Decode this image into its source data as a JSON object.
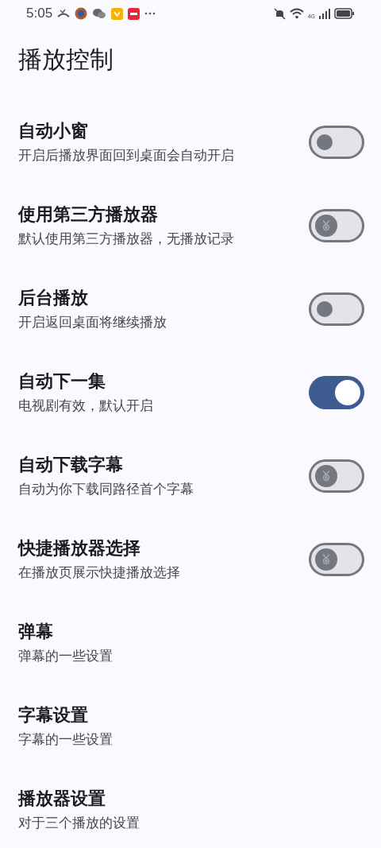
{
  "status_bar": {
    "time": "5:05",
    "network": "4G"
  },
  "title": "播放控制",
  "settings": [
    {
      "kind": "toggle",
      "title": "自动小窗",
      "subtitle": "开启后播放界面回到桌面会自动开启",
      "on": false,
      "badge": false
    },
    {
      "kind": "toggle",
      "title": "使用第三方播放器",
      "subtitle": "默认使用第三方播放器，无播放记录",
      "on": false,
      "badge": true
    },
    {
      "kind": "toggle",
      "title": "后台播放",
      "subtitle": "开启返回桌面将继续播放",
      "on": false,
      "badge": false
    },
    {
      "kind": "toggle",
      "title": "自动下一集",
      "subtitle": "电视剧有效，默认开启",
      "on": true,
      "badge": false
    },
    {
      "kind": "toggle",
      "title": "自动下载字幕",
      "subtitle": "自动为你下载同路径首个字幕",
      "on": false,
      "badge": true
    },
    {
      "kind": "toggle",
      "title": "快捷播放器选择",
      "subtitle": "在播放页展示快捷播放选择",
      "on": false,
      "badge": true
    },
    {
      "kind": "link",
      "title": "弹幕",
      "subtitle": "弹幕的一些设置"
    },
    {
      "kind": "link",
      "title": "字幕设置",
      "subtitle": "字幕的一些设置"
    },
    {
      "kind": "link",
      "title": "播放器设置",
      "subtitle": "对于三个播放的设置"
    }
  ]
}
